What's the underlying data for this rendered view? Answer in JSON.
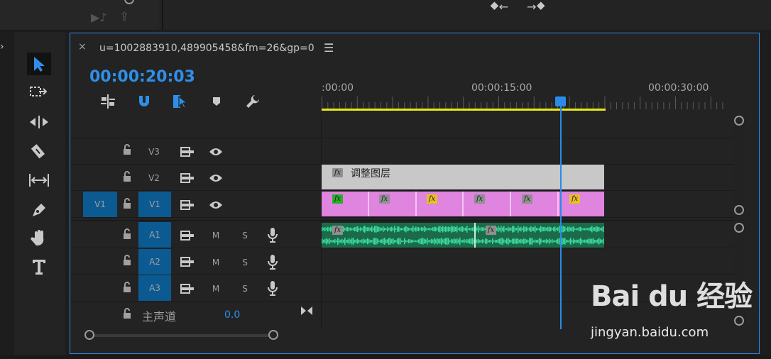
{
  "sequence": {
    "tab_title": "u=1002883910,489905458&fm=26&gp=0",
    "close_glyph": "×",
    "menu_glyph": "☰",
    "timecode": "00:00:20:03"
  },
  "ruler": {
    "labels": [
      ":00:00",
      "00:00:15:00",
      "00:00:30:00"
    ]
  },
  "tracks": {
    "v3": {
      "label": "V3"
    },
    "v2": {
      "label": "V2"
    },
    "v1": {
      "source": "V1",
      "label": "V1"
    },
    "a1": {
      "label": "A1",
      "m": "M",
      "s": "S"
    },
    "a2": {
      "label": "A2",
      "m": "M",
      "s": "S"
    },
    "a3": {
      "label": "A3",
      "m": "M",
      "s": "S"
    },
    "master": {
      "label": "主声道",
      "value": "0.0"
    }
  },
  "clips": {
    "adjustment_layer": "调整图层",
    "fx_label": "fx"
  },
  "watermark": {
    "main": "Bai du 经验",
    "sub": "jingyan.baidu.com"
  },
  "colors": {
    "accent_blue": "#2f8fe8",
    "video_clip": "#df84df",
    "audio_clip": "#1c6a4c",
    "adjust_clip": "#c8c8c8",
    "work_area": "#e8e81c",
    "fx_green": "#28b028",
    "fx_yellow": "#e8c020",
    "fx_gray": "#909090"
  }
}
